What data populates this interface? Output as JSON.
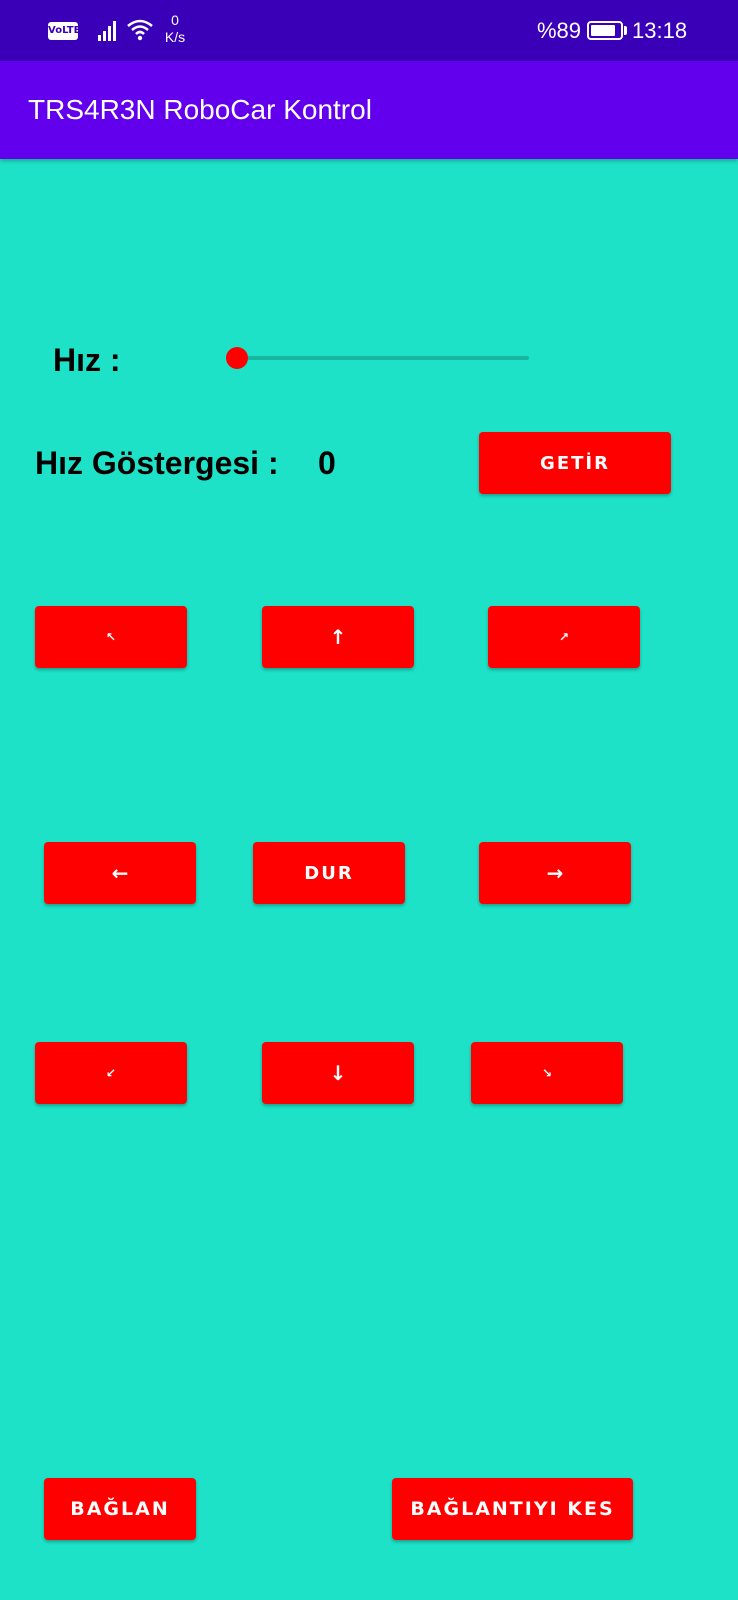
{
  "status_bar": {
    "volte": "VoLTE",
    "net_speed_value": "0",
    "net_speed_unit": "K/s",
    "battery_text": "%89",
    "battery_level_pct": 89,
    "time": "13:18"
  },
  "app_bar": {
    "title": "TRS4R3N RoboCar Kontrol"
  },
  "speed": {
    "label": "Hız :",
    "slider_value_pct": 0
  },
  "gauge": {
    "label": "Hız Göstergesi :",
    "value": "0",
    "fetch_button": "GETİR"
  },
  "directions": {
    "up_left": "↖",
    "up": "↑",
    "up_right": "↗",
    "left": "←",
    "stop": "DUR",
    "right": "→",
    "down_left": "↙",
    "down": "↓",
    "down_right": "↘"
  },
  "connection": {
    "connect": "BAĞLAN",
    "disconnect": "BAĞLANTIYI KES"
  },
  "colors": {
    "status_bar": "#3A00B7",
    "app_bar": "#6200EE",
    "background": "#1DE2C8",
    "button": "#FF0000"
  }
}
